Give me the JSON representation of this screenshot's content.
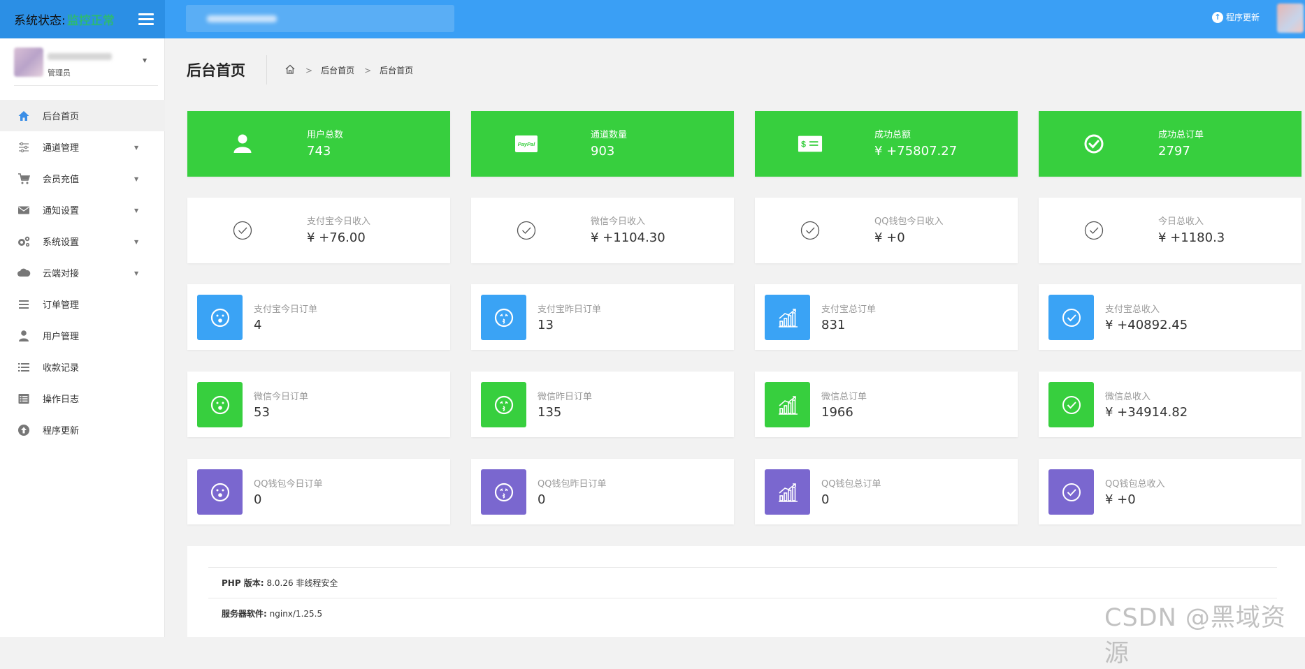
{
  "header": {
    "status_label": "系统状态:",
    "status_value": "监控正常",
    "update_label": "程序更新"
  },
  "user": {
    "role": "管理员"
  },
  "sidebar": {
    "items": [
      {
        "label": "后台首页",
        "icon": "home-icon",
        "active": true
      },
      {
        "label": "通道管理",
        "icon": "sliders-icon",
        "caret": true
      },
      {
        "label": "会员充值",
        "icon": "cart-icon",
        "caret": true
      },
      {
        "label": "通知设置",
        "icon": "envelope-icon",
        "caret": true
      },
      {
        "label": "系统设置",
        "icon": "gears-icon",
        "caret": true
      },
      {
        "label": "云端对接",
        "icon": "cloud-icon",
        "caret": true
      },
      {
        "label": "订单管理",
        "icon": "list-icon"
      },
      {
        "label": "用户管理",
        "icon": "user-icon"
      },
      {
        "label": "收款记录",
        "icon": "list-bullet-icon"
      },
      {
        "label": "操作日志",
        "icon": "log-icon"
      },
      {
        "label": "程序更新",
        "icon": "upload-circle-icon"
      }
    ]
  },
  "page": {
    "title": "后台首页",
    "breadcrumb": [
      "后台首页",
      "后台首页"
    ]
  },
  "summary_cards": [
    {
      "label": "用户总数",
      "value": "743",
      "icon": "user-icon"
    },
    {
      "label": "通道数量",
      "value": "903",
      "icon": "paypal-icon"
    },
    {
      "label": "成功总额",
      "value": "¥ +75807.27",
      "icon": "money-icon"
    },
    {
      "label": "成功总订单",
      "value": "2797",
      "icon": "check-circle-icon"
    }
  ],
  "today_cards": [
    {
      "label": "支付宝今日收入",
      "value": "¥ +76.00"
    },
    {
      "label": "微信今日收入",
      "value": "¥ +1104.30"
    },
    {
      "label": "QQ钱包今日收入",
      "value": "¥ +0"
    },
    {
      "label": "今日总收入",
      "value": "¥ +1180.3"
    }
  ],
  "stat_rows": [
    [
      {
        "label": "支付宝今日订单",
        "value": "4",
        "icon": "surprised-face-icon"
      },
      {
        "label": "支付宝昨日订单",
        "value": "13",
        "icon": "kiss-face-icon"
      },
      {
        "label": "支付宝总订单",
        "value": "831",
        "icon": "chart-up-icon"
      },
      {
        "label": "支付宝总收入",
        "value": "¥ +40892.45",
        "icon": "check-circle-icon"
      }
    ],
    [
      {
        "label": "微信今日订单",
        "value": "53",
        "icon": "surprised-face-icon"
      },
      {
        "label": "微信昨日订单",
        "value": "135",
        "icon": "kiss-face-icon"
      },
      {
        "label": "微信总订单",
        "value": "1966",
        "icon": "chart-up-icon"
      },
      {
        "label": "微信总收入",
        "value": "¥ +34914.82",
        "icon": "check-circle-icon"
      }
    ],
    [
      {
        "label": "QQ钱包今日订单",
        "value": "0",
        "icon": "surprised-face-icon"
      },
      {
        "label": "QQ钱包昨日订单",
        "value": "0",
        "icon": "kiss-face-icon"
      },
      {
        "label": "QQ钱包总订单",
        "value": "0",
        "icon": "chart-up-icon"
      },
      {
        "label": "QQ钱包总收入",
        "value": "¥ +0",
        "icon": "check-circle-icon"
      }
    ]
  ],
  "system_info": [
    {
      "label": "PHP 版本:",
      "value": "8.0.26 非线程安全"
    },
    {
      "label": "服务器软件:",
      "value": "nginx/1.25.5"
    }
  ],
  "watermark": "CSDN @黑域资源",
  "colors": {
    "header": "#3a9ff5",
    "green": "#37cf3e",
    "blue": "#3aa3f5",
    "purple": "#7a67cf"
  }
}
